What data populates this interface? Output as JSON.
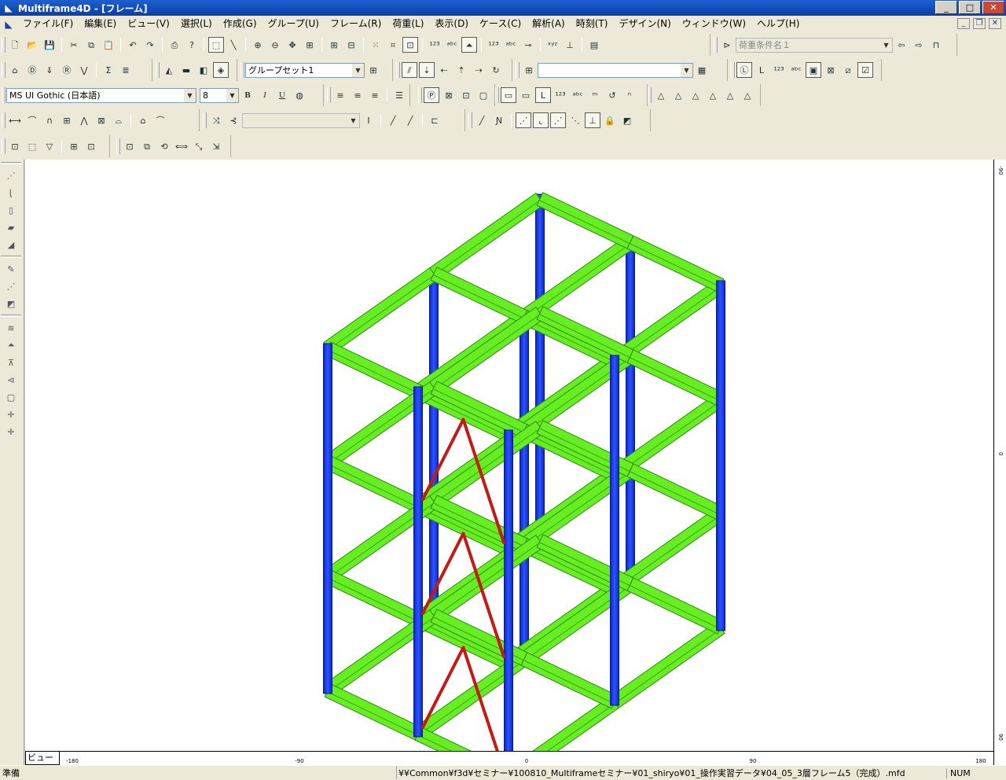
{
  "window": {
    "title": "Multiframe4D - [フレーム]",
    "app_icon": "app-logo-icon",
    "buttons": {
      "minimize": "_",
      "maximize": "□",
      "close": "✕"
    }
  },
  "menu": {
    "items": [
      "ファイル(F)",
      "編集(E)",
      "ビュー(V)",
      "選択(L)",
      "作成(G)",
      "グループ(U)",
      "フレーム(R)",
      "荷重(L)",
      "表示(D)",
      "ケース(C)",
      "解析(A)",
      "時刻(T)",
      "デザイン(N)",
      "ウィンドウ(W)",
      "ヘルプ(H)"
    ],
    "mdi": {
      "minimize": "_",
      "restore": "❐",
      "close": "✕"
    }
  },
  "toolbar": {
    "load_case": "荷重条件名１",
    "group_set": "グループセット1",
    "section_combo": "",
    "font_name": "MS UI Gothic (日本語)",
    "font_size": "8",
    "bold": "B",
    "italic": "I",
    "underline": "U",
    "disabled_combo": ""
  },
  "status": {
    "ready": "準備",
    "path": "¥¥Common¥f3d¥セミナー¥100810_Multiframeセミナー¥01_shiryo¥01_操作実習データ¥04_05_3層フレーム5（完成）.mfd",
    "num": "NUM"
  },
  "view_tab": "ビュー",
  "rulers": {
    "h_labels": [
      "-180",
      "-90",
      "0",
      "90",
      "180"
    ],
    "v_labels": [
      "-90",
      "0",
      "90"
    ]
  },
  "colors": {
    "beam": "#66ee22",
    "column": "#1e3df0",
    "brace": "#c41a12",
    "titlebar": "#0a3fa8"
  }
}
